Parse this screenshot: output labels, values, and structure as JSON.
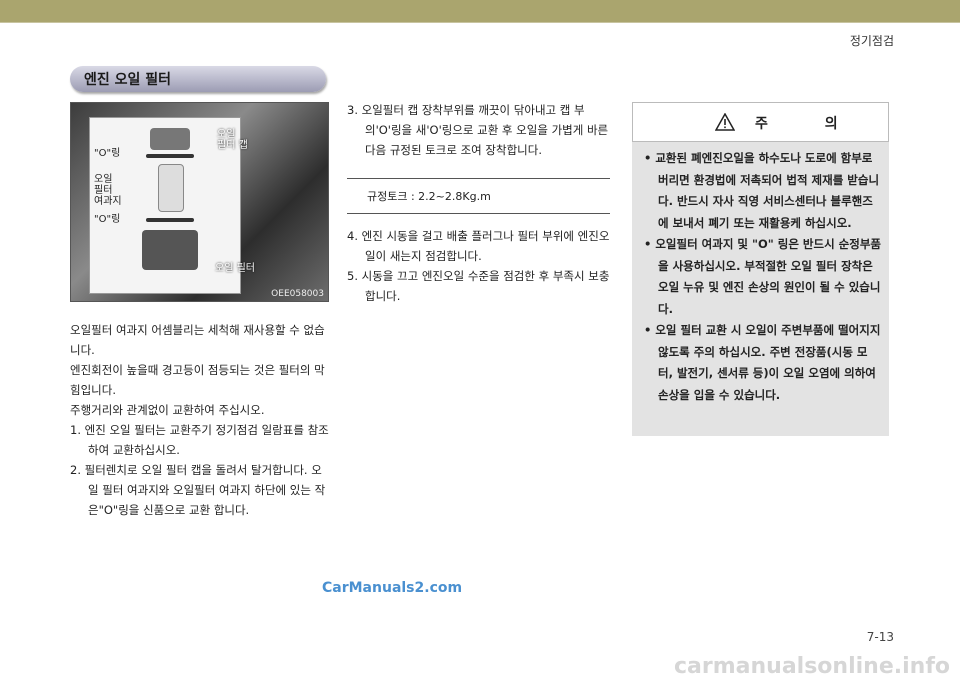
{
  "header": {
    "section_title": "정기점검"
  },
  "subtitle": "엔진 오일 필터",
  "photo": {
    "labels": {
      "oring_top": "\"O\"링",
      "filter_case": "오일\n필터\n여과지",
      "oring_bottom": "\"O\"링",
      "filter_cap": "오일\n필터 캡",
      "oil_filter": "오일 필터"
    },
    "code": "OEE058003"
  },
  "left_column": {
    "paragraphs": [
      "오일필터 여과지 어셈블리는 세척해 재사용할 수 없습니다.",
      "엔진회전이 높을때 경고등이 점등되는 것은 필터의 막힘입니다.",
      "주행거리와 관계없이 교환하여 주십시오."
    ],
    "steps": [
      "1.  엔진 오일 필터는 교환주기 정기점검 일람표를 참조하여 교환하십시오.",
      "2.  필터렌치로 오일 필터 캡을 돌려서 탈거합니다. 오일 필터 여과지와 오일필터 여과지 하단에 있는 작은\"O\"링을 신품으로 교환 합니다."
    ]
  },
  "middle_column": {
    "step3": "3.  오일필터 캡 장착부위를 깨끗이 닦아내고 캡 부의'O'링을 새'O'링으로 교환 후 오일을 가볍게 바른 다음 규정된 토크로 조여 장착합니다.",
    "spec": "규정토크 : 2.2~2.8Kg.m",
    "steps_after": [
      "4.  엔진 시동을 걸고 배출 플러그나 필터 부위에 엔진오일이 새는지 점검합니다.",
      "5.  시동을 끄고 엔진오일 수준을 점검한 후 부족시 보충합니다."
    ]
  },
  "caution": {
    "title": "주 의",
    "items": [
      "•  교환된 폐엔진오일을 하수도나 도로에 함부로 버리면 환경법에 저촉되어 법적 제재를 받습니다. 반드시 자사 직영 서비스센터나 블루핸즈에 보내서 폐기 또는 재활용케 하십시오.",
      "•  오일필터 여과지 및 \"O\" 링은 반드시 순정부품을 사용하십시오. 부적절한 오일 필터 장착은 오일 누유 및 엔진 손상의 원인이 될 수 있습니다.",
      "•  오일 필터 교환 시 오일이 주변부품에 떨어지지 않도록 주의 하십시오. 주변 전장품(시동 모터, 발전기, 센서류 등)이 오일 오염에 의하여 손상을 입을 수 있습니다."
    ]
  },
  "footer": {
    "watermark_top": "CarManuals2.com",
    "page_number": "7-13",
    "watermark_bottom": "carmanualsonline.info"
  },
  "colors": {
    "top_band": "#aaa56e",
    "caution_bg": "#e3e3e3",
    "watermark_blue": "#4a90d0"
  },
  "icons": [
    "warning-triangle-icon"
  ]
}
